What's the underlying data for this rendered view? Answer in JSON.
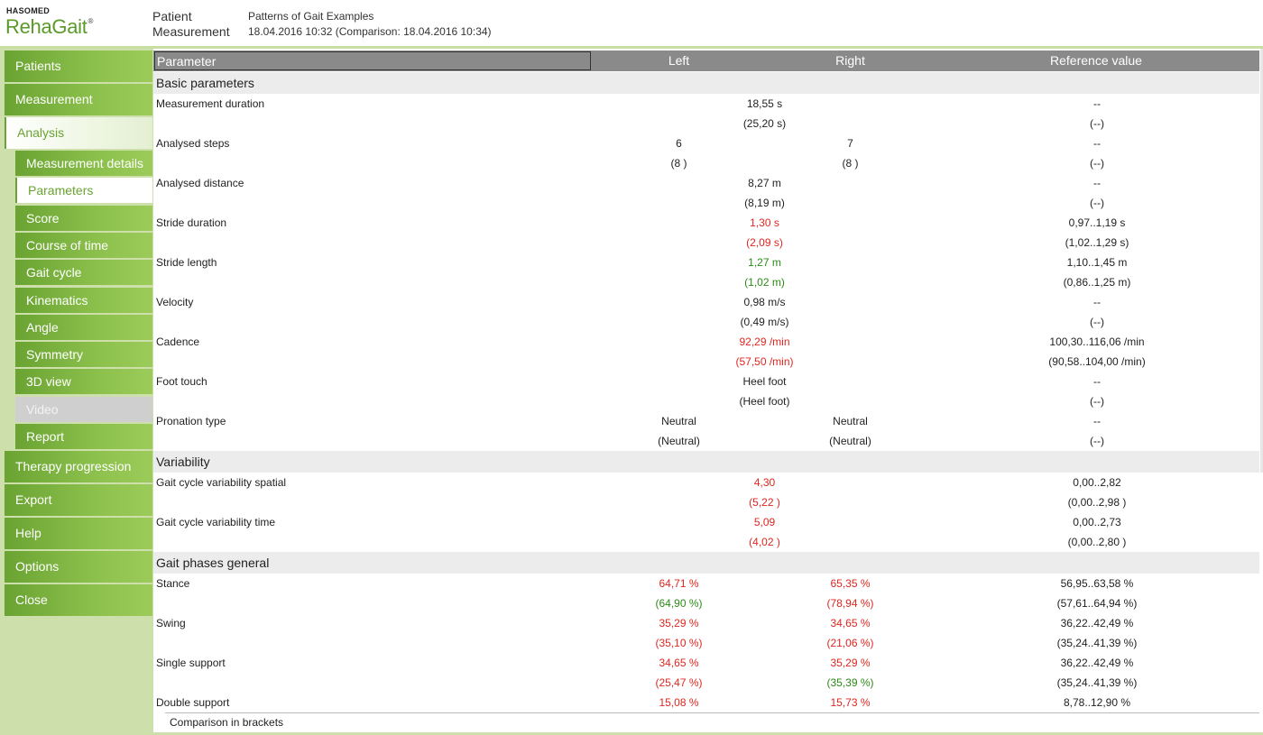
{
  "header": {
    "brand": "HASOMED",
    "app_name": "RehaGait",
    "registered": "®",
    "label_patient": "Patient",
    "label_measurement": "Measurement",
    "patient_value": "Patterns of Gait Examples",
    "measurement_value": "18.04.2016 10:32 (Comparison: 18.04.2016 10:34)"
  },
  "sidebar": {
    "items": [
      {
        "label": "Patients"
      },
      {
        "label": "Measurement"
      },
      {
        "label": "Analysis"
      },
      {
        "label": "Therapy progression"
      },
      {
        "label": "Export"
      },
      {
        "label": "Help"
      },
      {
        "label": "Options"
      },
      {
        "label": "Close"
      }
    ],
    "analysis_subitems": [
      {
        "label": "Measurement details"
      },
      {
        "label": "Parameters"
      },
      {
        "label": "Score"
      },
      {
        "label": "Course of time"
      },
      {
        "label": "Gait cycle"
      },
      {
        "label": "Kinematics"
      },
      {
        "label": "Angle"
      },
      {
        "label": "Symmetry"
      },
      {
        "label": "3D view"
      },
      {
        "label": "Video"
      },
      {
        "label": "Report"
      }
    ],
    "selected_item": "Analysis",
    "selected_subitem": "Parameters",
    "disabled_subitem": "Video"
  },
  "table": {
    "columns": {
      "parameter": "Parameter",
      "left": "Left",
      "right": "Right",
      "reference": "Reference value"
    },
    "sections": [
      {
        "title": "Basic parameters"
      },
      {
        "title": "Variability"
      },
      {
        "title": "Gait phases general"
      }
    ],
    "rows": {
      "measurement_duration": {
        "name": "Measurement duration",
        "value": "18,55 s",
        "cmp": "(25,20 s)",
        "ref": "--",
        "ref_cmp": "(--)"
      },
      "analysed_steps": {
        "name": "Analysed steps",
        "left": "6",
        "left_cmp": "(8 )",
        "right": "7",
        "right_cmp": "(8 )",
        "ref": "--",
        "ref_cmp": "(--)"
      },
      "analysed_distance": {
        "name": "Analysed distance",
        "value": "8,27 m",
        "cmp": "(8,19 m)",
        "ref": "--",
        "ref_cmp": "(--)"
      },
      "stride_duration": {
        "name": "Stride duration",
        "value": "1,30 s",
        "cmp": "(2,09 s)",
        "ref": "0,97..1,19 s",
        "ref_cmp": "(1,02..1,29 s)"
      },
      "stride_length": {
        "name": "Stride length",
        "value": "1,27 m",
        "cmp": "(1,02 m)",
        "ref": "1,10..1,45 m",
        "ref_cmp": "(0,86..1,25 m)"
      },
      "velocity": {
        "name": "Velocity",
        "value": "0,98 m/s",
        "cmp": "(0,49 m/s)",
        "ref": "--",
        "ref_cmp": "(--)"
      },
      "cadence": {
        "name": "Cadence",
        "value": "92,29 /min",
        "cmp": "(57,50 /min)",
        "ref": "100,30..116,06 /min",
        "ref_cmp": "(90,58..104,00 /min)"
      },
      "foot_touch": {
        "name": "Foot touch",
        "value": "Heel foot",
        "cmp": "(Heel foot)",
        "ref": "--",
        "ref_cmp": "(--)"
      },
      "pronation_type": {
        "name": "Pronation type",
        "left": "Neutral",
        "left_cmp": "(Neutral)",
        "right": "Neutral",
        "right_cmp": "(Neutral)",
        "ref": "--",
        "ref_cmp": "(--)"
      },
      "gcv_spatial": {
        "name": "Gait cycle variability spatial",
        "value": "4,30",
        "cmp": "(5,22 )",
        "ref": "0,00..2,82",
        "ref_cmp": "(0,00..2,98 )"
      },
      "gcv_time": {
        "name": "Gait cycle variability time",
        "value": "5,09",
        "cmp": "(4,02 )",
        "ref": "0,00..2,73",
        "ref_cmp": "(0,00..2,80 )"
      },
      "stance": {
        "name": "Stance",
        "left": "64,71 %",
        "left_cmp": "(64,90 %)",
        "right": "65,35 %",
        "right_cmp": "(78,94 %)",
        "ref": "56,95..63,58 %",
        "ref_cmp": "(57,61..64,94 %)"
      },
      "swing": {
        "name": "Swing",
        "left": "35,29 %",
        "left_cmp": "(35,10 %)",
        "right": "34,65 %",
        "right_cmp": "(21,06 %)",
        "ref": "36,22..42,49 %",
        "ref_cmp": "(35,24..41,39 %)"
      },
      "single_support": {
        "name": "Single support",
        "left": "34,65 %",
        "left_cmp": "(25,47 %)",
        "right": "35,29 %",
        "right_cmp": "(35,39 %)",
        "ref": "36,22..42,49 %",
        "ref_cmp": "(35,24..41,39 %)"
      },
      "double_support": {
        "name": "Double support",
        "left": "15,08 %",
        "right": "15,73 %",
        "ref": "8,78..12,90 %"
      }
    },
    "footer_note": "Comparison in brackets"
  },
  "colors": {
    "accent_green": "#6aa332",
    "out_of_range": "#e0261f",
    "in_range": "#2a8a16",
    "header_bar": "#8a8a8a"
  }
}
